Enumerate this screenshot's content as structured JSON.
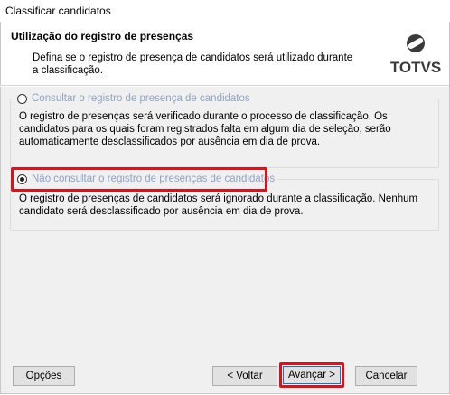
{
  "window": {
    "title": "Classificar candidatos"
  },
  "header": {
    "title": "Utilização do registro de presenças",
    "description": "Defina se o registro de presença de candidatos será utilizado durante a classificação.",
    "logo_text": "TOTVS"
  },
  "options": [
    {
      "label": "Consultar o registro de presença de candidatos",
      "selected": false,
      "description": "O registro de presenças será verificado durante o processo de classificação. Os candidatos para os quais foram registrados falta em algum dia de seleção, serão automaticamente desclassificados por ausência em dia de prova."
    },
    {
      "label": "Não consultar o registro de presenças de candidatos",
      "selected": true,
      "description": "O registro de presenças de candidatos será ignorado durante a classificação. Nenhum candidato será desclassificado por ausência em dia de prova."
    }
  ],
  "buttons": {
    "options": "Opções",
    "back": "< Voltar",
    "next": "Avançar >",
    "cancel": "Cancelar"
  },
  "colors": {
    "highlight": "#e0101a",
    "radio_label": "#8ea4c4"
  }
}
